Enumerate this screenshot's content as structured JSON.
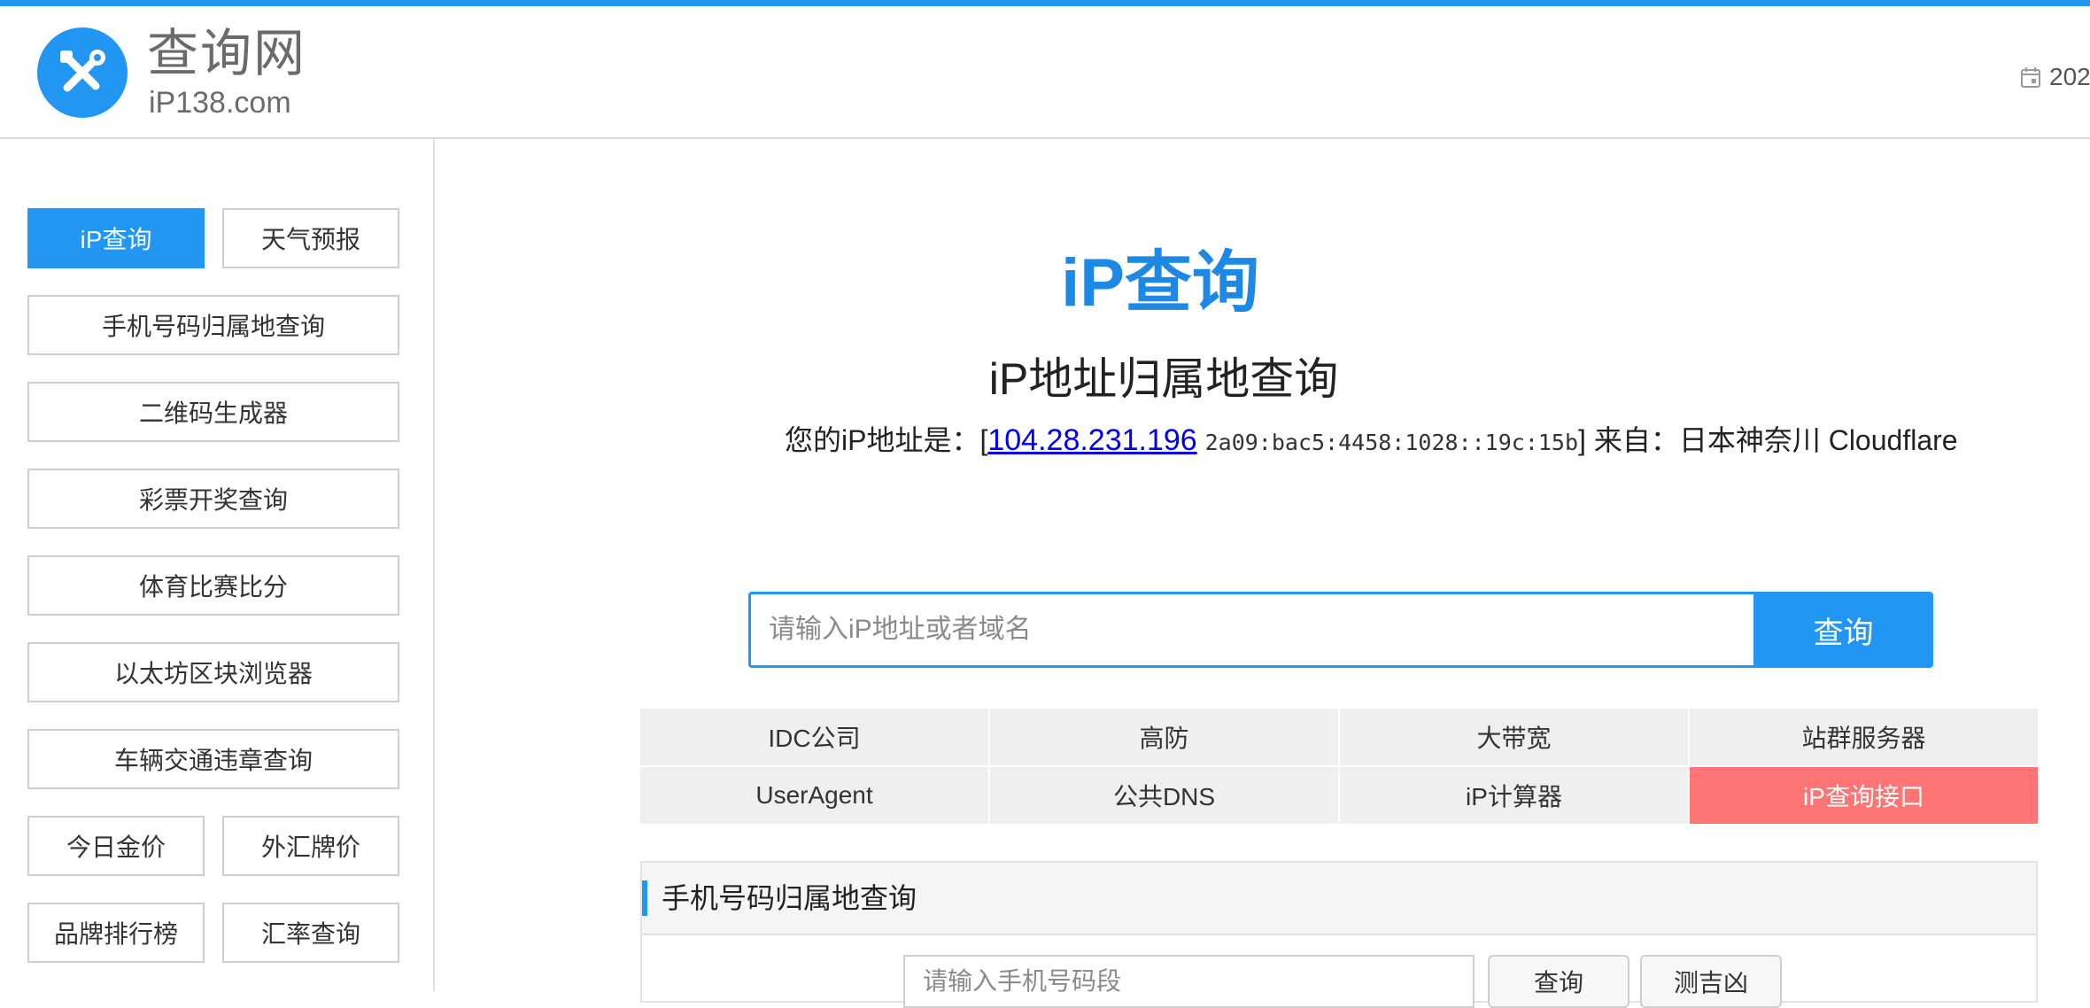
{
  "header": {
    "logo_title": "查询网",
    "logo_sub": "iP138.com",
    "date_text": "202"
  },
  "sidebar": {
    "items": [
      {
        "label": "iP查询",
        "active": true
      },
      {
        "label": "天气预报"
      },
      {
        "label": "手机号码归属地查询"
      },
      {
        "label": "二维码生成器"
      },
      {
        "label": "彩票开奖查询"
      },
      {
        "label": "体育比赛比分"
      },
      {
        "label": "以太坊区块浏览器"
      },
      {
        "label": "车辆交通违章查询"
      },
      {
        "label": "今日金价"
      },
      {
        "label": "外汇牌价"
      },
      {
        "label": "品牌排行榜"
      },
      {
        "label": "汇率查询"
      }
    ]
  },
  "main": {
    "title": "iP查询",
    "subtitle": "iP地址归属地查询",
    "ip_prefix": "您的iP地址是：[",
    "ip_address": "104.28.231.196",
    "ipv6": "2a09:bac5:4458:1028::19c:15b",
    "ip_suffix": "] 来自：日本神奈川 Cloudflare",
    "search_placeholder": "请输入iP地址或者域名",
    "search_button": "查询",
    "quick_links": [
      "IDC公司",
      "高防",
      "大带宽",
      "站群服务器",
      "UserAgent",
      "公共DNS",
      "iP计算器",
      "iP查询接口"
    ],
    "accent_color": "#ff7474"
  },
  "phone": {
    "title": "手机号码归属地查询",
    "placeholder": "请输入手机号码段",
    "query_button": "查询",
    "luck_button": "测吉凶"
  }
}
